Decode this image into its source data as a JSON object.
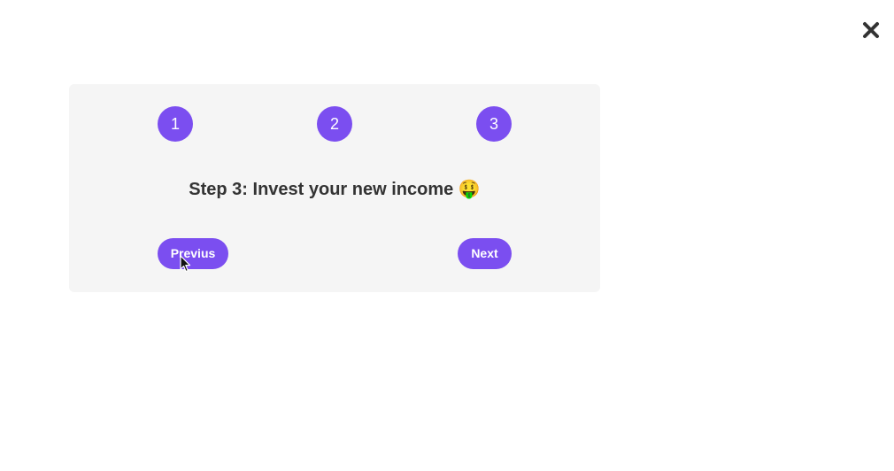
{
  "window": {
    "close_icon": "close-icon"
  },
  "stepper": {
    "steps": [
      {
        "label": "1"
      },
      {
        "label": "2"
      },
      {
        "label": "3"
      }
    ],
    "current_step": 3,
    "title": "Step 3: Invest your new income 🤑"
  },
  "navigation": {
    "previous_label": "Previus",
    "next_label": "Next"
  },
  "colors": {
    "accent": "#7b4ef0",
    "card_background": "#f5f5f5",
    "text": "#333333",
    "page_background": "#ffffff"
  }
}
